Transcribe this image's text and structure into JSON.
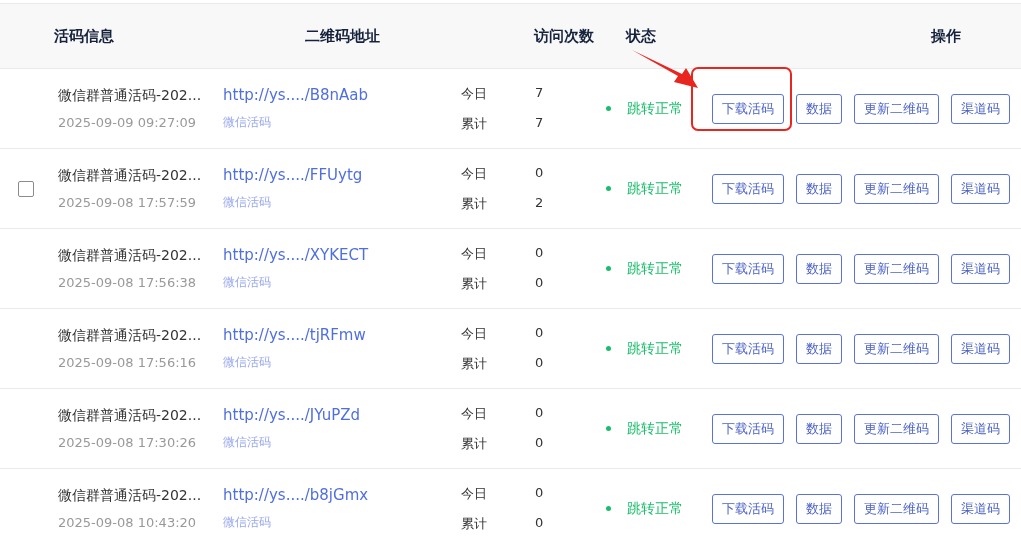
{
  "table": {
    "columns": [
      "活码信息",
      "二维码地址",
      "访问次数",
      "状态",
      "操作"
    ],
    "rows": [
      {
        "name": "微信群普通活码-202...",
        "created": "2025-09-09 09:27:09",
        "url": "http://ys..../B8nAab",
        "type": "微信活码",
        "today_label": "今日",
        "today": "7",
        "total_label": "累计",
        "total": "7",
        "status": "跳转正常",
        "highlighted": true,
        "actions": [
          "下载活码",
          "数据",
          "更新二维码",
          "渠道码"
        ]
      },
      {
        "name": "微信群普通活码-202...",
        "created": "2025-09-08 17:57:59",
        "url": "http://ys..../FFUytg",
        "type": "微信活码",
        "today_label": "今日",
        "today": "0",
        "total_label": "累计",
        "total": "2",
        "status": "跳转正常",
        "checkbox": {
          "checked": false
        },
        "highlighted": false,
        "actions": [
          "下载活码",
          "数据",
          "更新二维码",
          "渠道码"
        ]
      },
      {
        "name": "微信群普通活码-202...",
        "created": "2025-09-08 17:56:38",
        "url": "http://ys..../XYKECT",
        "type": "微信活码",
        "today_label": "今日",
        "today": "0",
        "total_label": "累计",
        "total": "0",
        "status": "跳转正常",
        "highlighted": false,
        "actions": [
          "下载活码",
          "数据",
          "更新二维码",
          "渠道码"
        ]
      },
      {
        "name": "微信群普通活码-202...",
        "created": "2025-09-08 17:56:16",
        "url": "http://ys..../tjRFmw",
        "type": "微信活码",
        "today_label": "今日",
        "today": "0",
        "total_label": "累计",
        "total": "0",
        "status": "跳转正常",
        "highlighted": false,
        "actions": [
          "下载活码",
          "数据",
          "更新二维码",
          "渠道码"
        ]
      },
      {
        "name": "微信群普通活码-202...",
        "created": "2025-09-08 17:30:26",
        "url": "http://ys..../JYuPZd",
        "type": "微信活码",
        "today_label": "今日",
        "today": "0",
        "total_label": "累计",
        "total": "0",
        "status": "跳转正常",
        "highlighted": false,
        "actions": [
          "下载活码",
          "数据",
          "更新二维码",
          "渠道码"
        ]
      },
      {
        "name": "微信群普通活码-202...",
        "created": "2025-09-08 10:43:20",
        "url": "http://ys..../b8jGmx",
        "type": "微信活码",
        "today_label": "今日",
        "today": "0",
        "total_label": "累计",
        "total": "0",
        "status": "跳转正常",
        "highlighted": false,
        "actions": [
          "下载活码",
          "数据",
          "更新二维码",
          "渠道码"
        ]
      }
    ]
  }
}
